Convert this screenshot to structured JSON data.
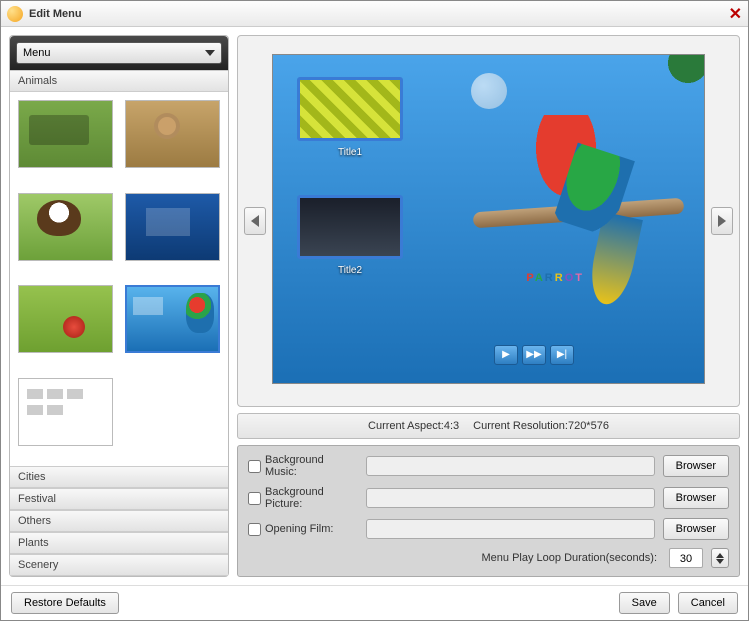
{
  "window": {
    "title": "Edit Menu"
  },
  "sidebar": {
    "combo_label": "Menu",
    "categories": [
      "Animals",
      "Cities",
      "Festival",
      "Others",
      "Plants",
      "Scenery"
    ],
    "open_index": 0
  },
  "preview": {
    "titles": [
      "Title1",
      "Title2"
    ],
    "theme_label": "PARROT"
  },
  "info": {
    "aspect_label": "Current Aspect:",
    "aspect_value": "4:3",
    "resolution_label": "Current Resolution:",
    "resolution_value": "720*576"
  },
  "settings": {
    "bg_music_label": "Background Music:",
    "bg_picture_label": "Background Picture:",
    "opening_film_label": "Opening Film:",
    "browser_label": "Browser",
    "loop_label": "Menu Play Loop Duration(seconds):",
    "loop_value": "30",
    "bg_music_value": "",
    "bg_picture_value": "",
    "opening_film_value": ""
  },
  "footer": {
    "restore": "Restore Defaults",
    "save": "Save",
    "cancel": "Cancel"
  }
}
